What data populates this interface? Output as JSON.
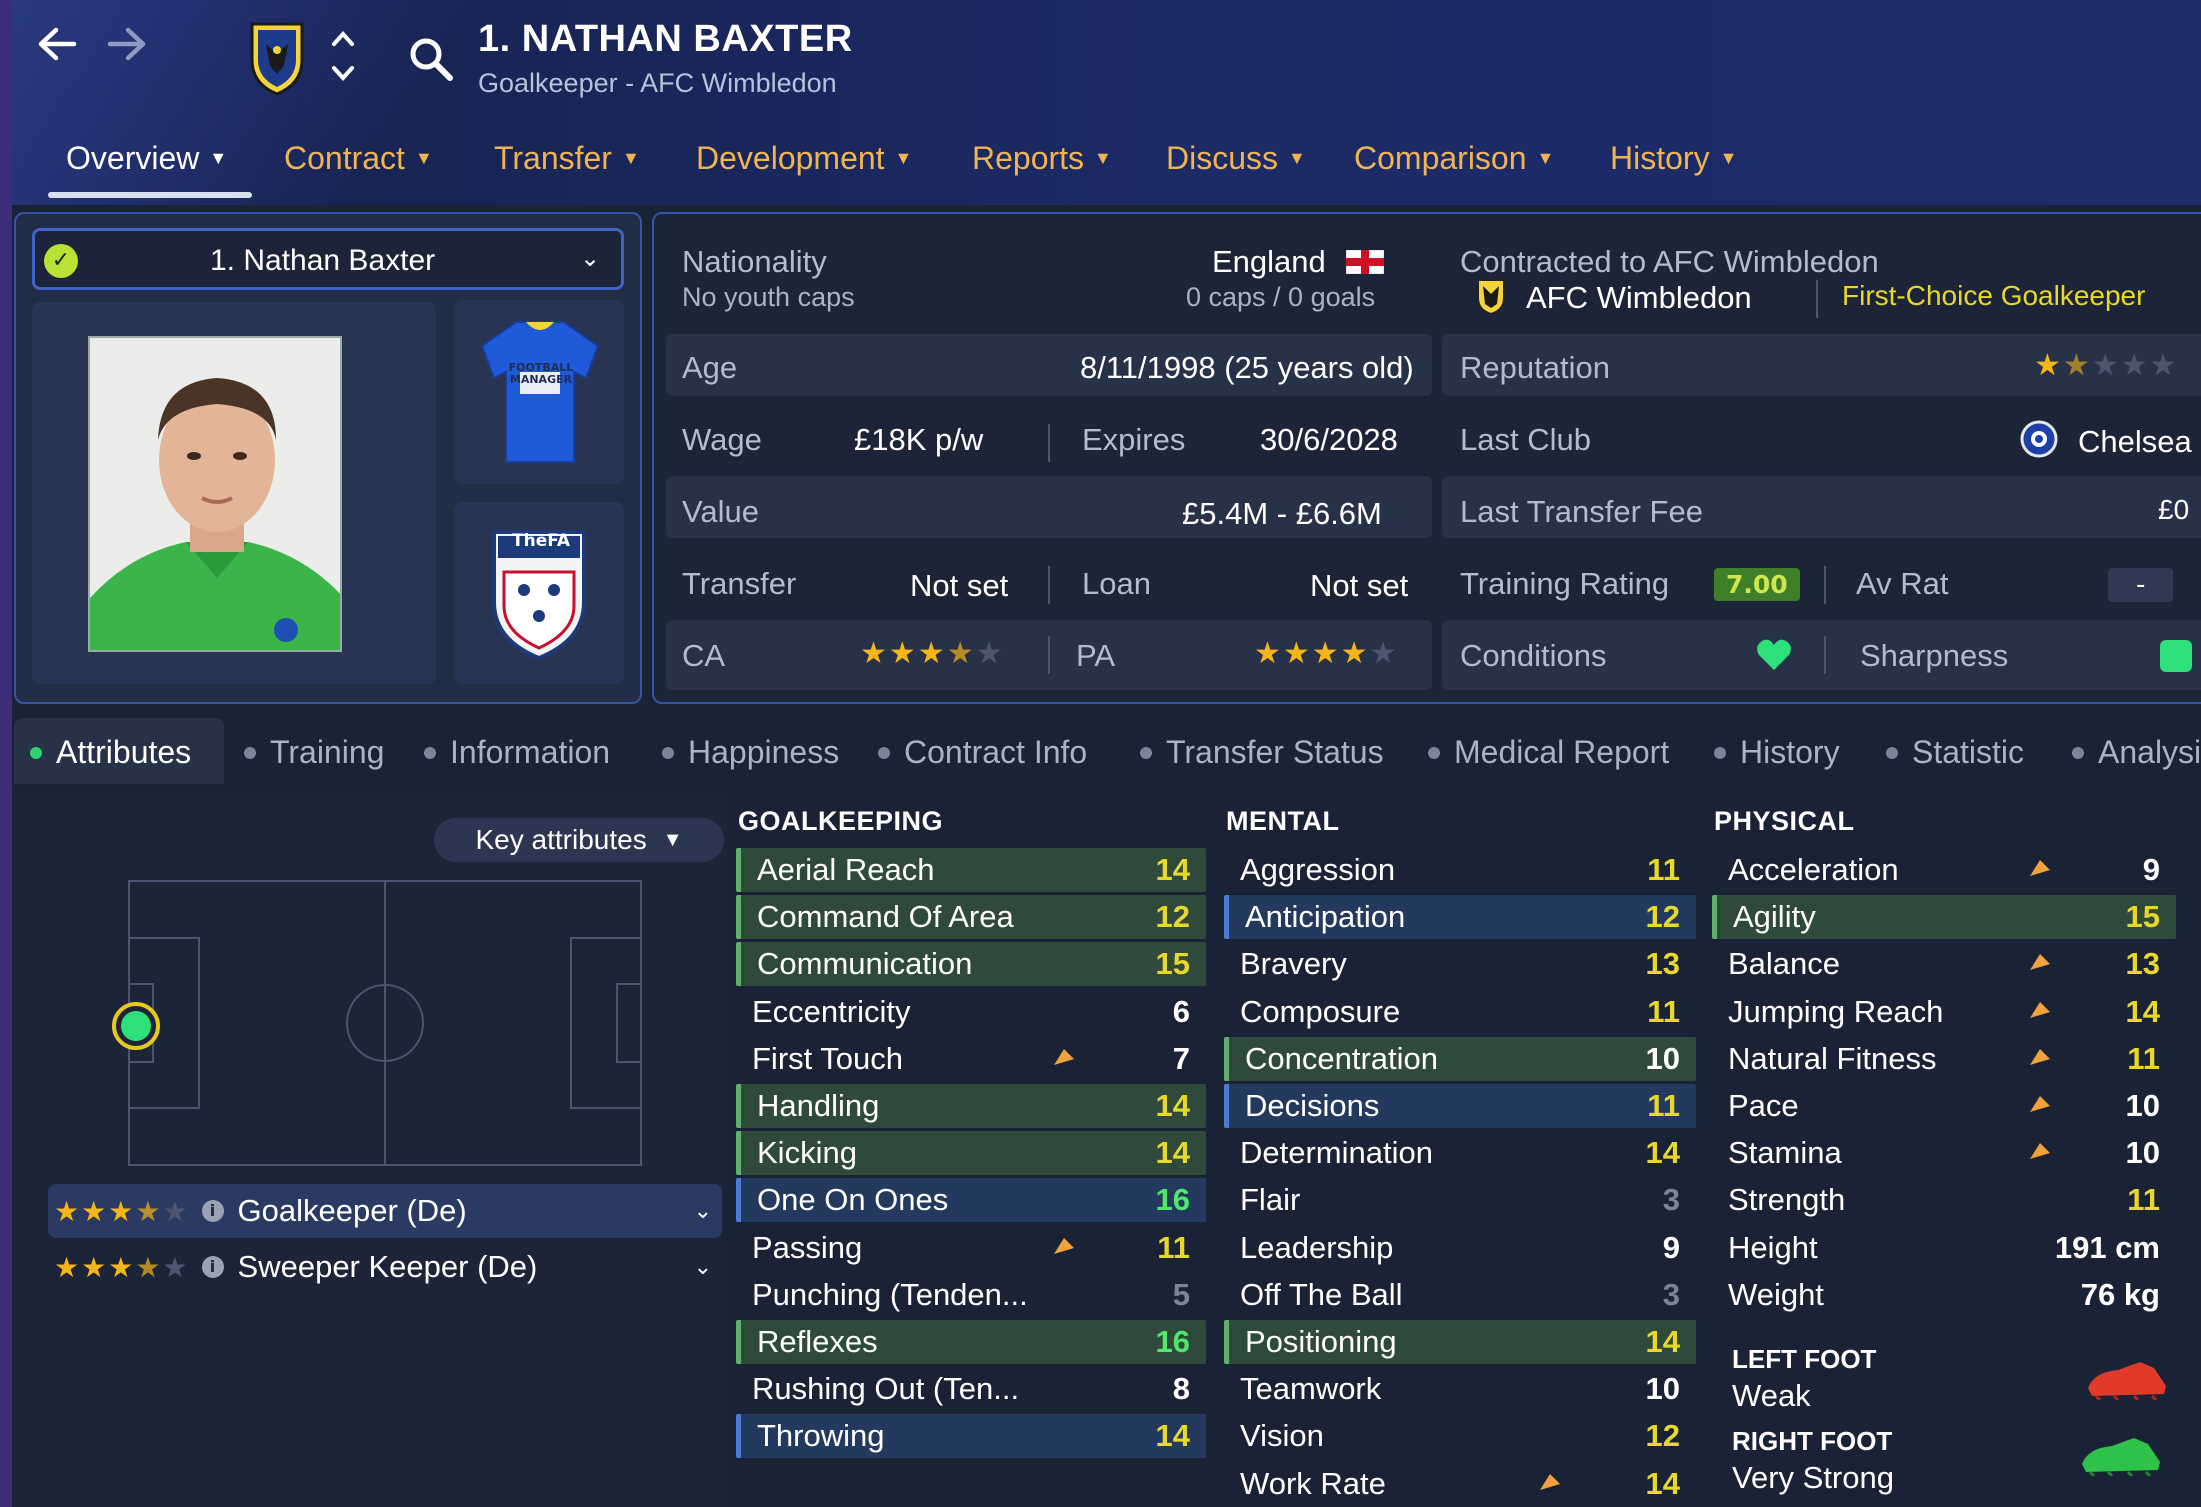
{
  "header": {
    "player_name": "1. NATHAN BAXTER",
    "subtitle": "Goalkeeper - AFC Wimbledon",
    "tabs": [
      {
        "label": "Overview"
      },
      {
        "label": "Contract"
      },
      {
        "label": "Transfer"
      },
      {
        "label": "Development"
      },
      {
        "label": "Reports"
      },
      {
        "label": "Discuss"
      },
      {
        "label": "Comparison"
      },
      {
        "label": "History"
      }
    ]
  },
  "profile": {
    "selector_label": "1. Nathan Baxter",
    "kit_text": "FOOTBALL MANAGER",
    "fa_text": "TheFA"
  },
  "info": {
    "nationality_label": "Nationality",
    "nationality_value": "England",
    "youth_caps": "No youth caps",
    "caps_goals": "0 caps / 0 goals",
    "contracted_label": "Contracted to AFC Wimbledon",
    "club": "AFC Wimbledon",
    "squad_status": "First-Choice Goalkeeper",
    "age_label": "Age",
    "age_value": "8/11/1998 (25 years old)",
    "reputation_label": "Reputation",
    "reputation_stars": 1.5,
    "wage_label": "Wage",
    "wage_value": "£18K p/w",
    "expires_label": "Expires",
    "expires_value": "30/6/2028",
    "last_club_label": "Last Club",
    "last_club_value": "Chelsea",
    "value_label": "Value",
    "value_value": "£5.4M - £6.6M",
    "last_fee_label": "Last Transfer Fee",
    "last_fee_value": "£0",
    "transfer_label": "Transfer",
    "transfer_value": "Not set",
    "loan_label": "Loan",
    "loan_value": "Not set",
    "training_rating_label": "Training Rating",
    "training_rating_value": "7.00",
    "avrat_label": "Av Rat",
    "avrat_value": "-",
    "ca_label": "CA",
    "ca_stars": 3.5,
    "pa_label": "PA",
    "pa_stars": 4,
    "conditions_label": "Conditions",
    "sharpness_label": "Sharpness"
  },
  "subtabs": [
    {
      "label": "Attributes"
    },
    {
      "label": "Training"
    },
    {
      "label": "Information"
    },
    {
      "label": "Happiness"
    },
    {
      "label": "Contract Info"
    },
    {
      "label": "Transfer Status"
    },
    {
      "label": "Medical Report"
    },
    {
      "label": "History"
    },
    {
      "label": "Statistic"
    },
    {
      "label": "Analysis"
    }
  ],
  "positions": {
    "key_attributes_label": "Key attributes",
    "roles": [
      {
        "name": "Goalkeeper (De)",
        "stars": 3.5
      },
      {
        "name": "Sweeper Keeper (De)",
        "stars": 3.5
      }
    ]
  },
  "attributes": {
    "goalkeeping": {
      "title": "GOALKEEPING",
      "items": [
        {
          "name": "Aerial Reach",
          "value": "14",
          "hl": "green",
          "color": "yellow",
          "arrow": false
        },
        {
          "name": "Command Of Area",
          "value": "12",
          "hl": "green",
          "color": "yellow",
          "arrow": false
        },
        {
          "name": "Communication",
          "value": "15",
          "hl": "green",
          "color": "yellow",
          "arrow": false
        },
        {
          "name": "Eccentricity",
          "value": "6",
          "hl": "",
          "color": "white",
          "arrow": false
        },
        {
          "name": "First Touch",
          "value": "7",
          "hl": "",
          "color": "white",
          "arrow": true
        },
        {
          "name": "Handling",
          "value": "14",
          "hl": "green",
          "color": "yellow",
          "arrow": false
        },
        {
          "name": "Kicking",
          "value": "14",
          "hl": "green",
          "color": "yellow",
          "arrow": false
        },
        {
          "name": "One On Ones",
          "value": "16",
          "hl": "blue",
          "color": "green",
          "arrow": false
        },
        {
          "name": "Passing",
          "value": "11",
          "hl": "",
          "color": "yellow",
          "arrow": true
        },
        {
          "name": "Punching (Tenden...",
          "value": "5",
          "hl": "",
          "color": "grey",
          "arrow": false
        },
        {
          "name": "Reflexes",
          "value": "16",
          "hl": "green",
          "color": "green",
          "arrow": false
        },
        {
          "name": "Rushing Out (Ten...",
          "value": "8",
          "hl": "",
          "color": "white",
          "arrow": false
        },
        {
          "name": "Throwing",
          "value": "14",
          "hl": "blue",
          "color": "yellow",
          "arrow": false
        }
      ]
    },
    "mental": {
      "title": "MENTAL",
      "items": [
        {
          "name": "Aggression",
          "value": "11",
          "hl": "",
          "color": "yellow",
          "arrow": false
        },
        {
          "name": "Anticipation",
          "value": "12",
          "hl": "blue",
          "color": "yellow",
          "arrow": false
        },
        {
          "name": "Bravery",
          "value": "13",
          "hl": "",
          "color": "yellow",
          "arrow": false
        },
        {
          "name": "Composure",
          "value": "11",
          "hl": "",
          "color": "yellow",
          "arrow": false
        },
        {
          "name": "Concentration",
          "value": "10",
          "hl": "green",
          "color": "white",
          "arrow": false
        },
        {
          "name": "Decisions",
          "value": "11",
          "hl": "blue",
          "color": "yellow",
          "arrow": false
        },
        {
          "name": "Determination",
          "value": "14",
          "hl": "",
          "color": "yellow",
          "arrow": false
        },
        {
          "name": "Flair",
          "value": "3",
          "hl": "",
          "color": "grey",
          "arrow": false
        },
        {
          "name": "Leadership",
          "value": "9",
          "hl": "",
          "color": "white",
          "arrow": false
        },
        {
          "name": "Off The Ball",
          "value": "3",
          "hl": "",
          "color": "grey",
          "arrow": false
        },
        {
          "name": "Positioning",
          "value": "14",
          "hl": "green",
          "color": "yellow",
          "arrow": false
        },
        {
          "name": "Teamwork",
          "value": "10",
          "hl": "",
          "color": "white",
          "arrow": false
        },
        {
          "name": "Vision",
          "value": "12",
          "hl": "",
          "color": "yellow",
          "arrow": false
        },
        {
          "name": "Work Rate",
          "value": "14",
          "hl": "",
          "color": "yellow",
          "arrow": true
        }
      ]
    },
    "physical": {
      "title": "PHYSICAL",
      "items": [
        {
          "name": "Acceleration",
          "value": "9",
          "hl": "",
          "color": "white",
          "arrow": true
        },
        {
          "name": "Agility",
          "value": "15",
          "hl": "green",
          "color": "yellow",
          "arrow": false
        },
        {
          "name": "Balance",
          "value": "13",
          "hl": "",
          "color": "yellow",
          "arrow": true
        },
        {
          "name": "Jumping Reach",
          "value": "14",
          "hl": "",
          "color": "yellow",
          "arrow": true
        },
        {
          "name": "Natural Fitness",
          "value": "11",
          "hl": "",
          "color": "yellow",
          "arrow": true
        },
        {
          "name": "Pace",
          "value": "10",
          "hl": "",
          "color": "white",
          "arrow": true
        },
        {
          "name": "Stamina",
          "value": "10",
          "hl": "",
          "color": "white",
          "arrow": true
        },
        {
          "name": "Strength",
          "value": "11",
          "hl": "",
          "color": "yellow",
          "arrow": false
        },
        {
          "name": "Height",
          "value": "191 cm",
          "hl": "",
          "color": "white",
          "arrow": false
        },
        {
          "name": "Weight",
          "value": "76 kg",
          "hl": "",
          "color": "white",
          "arrow": false
        }
      ]
    }
  },
  "feet": {
    "left_label": "LEFT FOOT",
    "left_value": "Weak",
    "right_label": "RIGHT FOOT",
    "right_value": "Very Strong"
  },
  "colors": {
    "accent_tab": "#f0b451",
    "star": "#f6b519",
    "value_yellow": "#e8d82d",
    "value_green": "#4fe86a",
    "highlight_green": "#2f4a3a",
    "highlight_blue": "#24395e"
  }
}
